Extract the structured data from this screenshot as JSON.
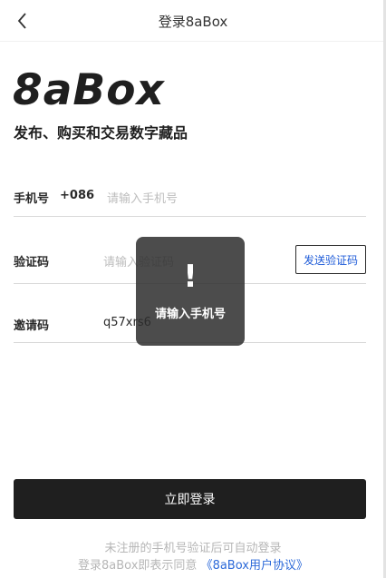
{
  "header": {
    "title": "登录8aBox",
    "back_icon": "chevron-left-icon"
  },
  "brand": {
    "logo": "8aBox",
    "tagline": "发布、购买和交易数字藏品"
  },
  "form": {
    "phone": {
      "label": "手机号",
      "country_code": "+086",
      "placeholder": "请输入手机号",
      "value": ""
    },
    "verify": {
      "label": "验证码",
      "placeholder": "请输入验证码",
      "value": "",
      "send_label": "发送验证码"
    },
    "invite": {
      "label": "邀请码",
      "value": "q57xrs6"
    }
  },
  "login_button": "立即登录",
  "notes": {
    "line1": "未注册的手机号验证后可自动登录",
    "line2_prefix": "登录8aBox即表示同意",
    "agreement_link": "《8aBox用户协议》"
  },
  "toast": {
    "icon": "!",
    "message": "请输入手机号"
  },
  "colors": {
    "primary_dark": "#1f1f1f",
    "link": "#2d6ad9",
    "placeholder": "#bdbdbd"
  }
}
